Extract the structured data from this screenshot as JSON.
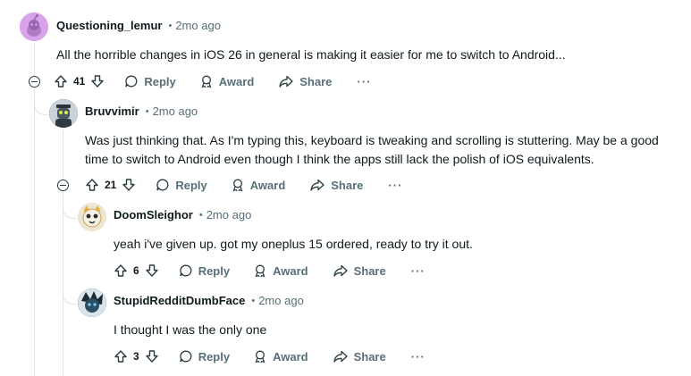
{
  "comments": [
    {
      "author": "Questioning_lemur",
      "time": "2mo ago",
      "text": "All the horrible changes in iOS 26 in general is making it easier for me to switch to Android...",
      "votes": "41",
      "reply": "Reply",
      "award": "Award",
      "share": "Share",
      "more": "···",
      "avatar_color": "#d8a3e8"
    },
    {
      "author": "Bruvvimir",
      "time": "2mo ago",
      "text_line1": "Was just thinking that. As I'm typing this, keyboard is tweaking and scrolling is stuttering. May be a good",
      "text_line2": "time to switch to Android even though I think the apps still lack the polish of iOS equivalents.",
      "votes": "21",
      "reply": "Reply",
      "award": "Award",
      "share": "Share",
      "more": "···",
      "avatar_color": "#3e4b55"
    },
    {
      "author": "DoomSleighor",
      "time": "2mo ago",
      "text": "yeah i've given up. got my oneplus 15 ordered, ready to try it out.",
      "votes": "6",
      "reply": "Reply",
      "award": "Award",
      "share": "Share",
      "more": "···",
      "avatar_color": "#f3d35a"
    },
    {
      "author": "StupidRedditDumbFace",
      "time": "2mo ago",
      "text": "I thought I was the only one",
      "votes": "3",
      "reply": "Reply",
      "award": "Award",
      "share": "Share",
      "more": "···",
      "avatar_color": "#1f3a4a"
    }
  ],
  "meta_separator": "•",
  "colors": {
    "text": "#0f1a1c",
    "muted": "#576f76",
    "thread_line": "#e0e3e5"
  }
}
